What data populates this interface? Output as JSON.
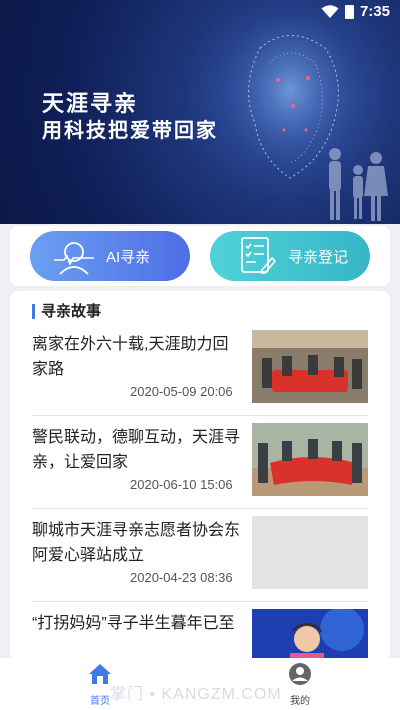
{
  "status": {
    "time": "7:35"
  },
  "banner": {
    "title_line1": "天涯寻亲",
    "title_line2": "用科技把爱带回家"
  },
  "actions": {
    "ai_search_label": "AI寻亲",
    "register_label": "寻亲登记"
  },
  "stories": {
    "heading": "寻亲故事",
    "items": [
      {
        "title": "离家在外六十载,天涯助力回家路",
        "date": "2020-05-09 20:06"
      },
      {
        "title": "警民联动，德聊互动，天涯寻亲，让爱回家",
        "date": "2020-06-10 15:06"
      },
      {
        "title": "聊城市天涯寻亲志愿者协会东阿爱心驿站成立",
        "date": "2020-04-23 08:36"
      },
      {
        "title": "“打拐妈妈”寻子半生暮年已至",
        "date": ""
      }
    ]
  },
  "nav": {
    "home_label": "首页",
    "mine_label": "我的"
  },
  "watermark": "掌门 • KANGZM.COM"
}
